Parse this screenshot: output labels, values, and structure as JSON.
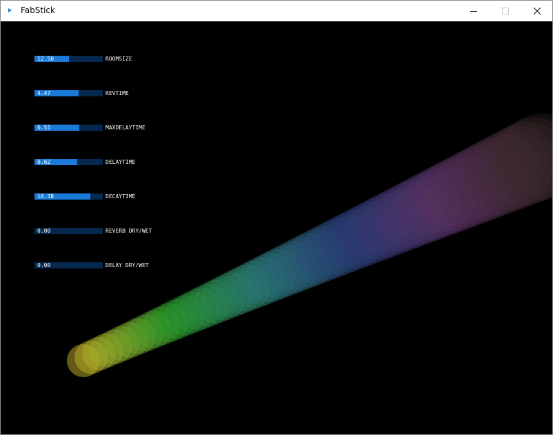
{
  "window": {
    "title": "FabStick",
    "minimize_icon": "minimize-icon",
    "maximize_icon": "maximize-icon",
    "close_icon": "close-icon"
  },
  "sliders": [
    {
      "value": "12.50",
      "label": "ROOMSIZE",
      "fill_fraction": 0.5
    },
    {
      "value": "4.47",
      "label": "REVTIME",
      "fill_fraction": 0.65
    },
    {
      "value": "6.51",
      "label": "MAXDELAYTIME",
      "fill_fraction": 0.66
    },
    {
      "value": "0.62",
      "label": "DELAYTIME",
      "fill_fraction": 0.63
    },
    {
      "value": "16.38",
      "label": "DECAYTIME",
      "fill_fraction": 0.82
    },
    {
      "value": "0.00",
      "label": "REVERB DRY/WET",
      "fill_fraction": 0.0
    },
    {
      "value": "0.00",
      "label": "DELAY DRY/WET",
      "fill_fraction": 0.0
    }
  ],
  "colors": {
    "slider_track": "#05294e",
    "slider_fill": "#1a7ad8",
    "background": "#000000",
    "trail_start": "#c8b42a",
    "trail_green": "#2a9a2a",
    "trail_teal": "#2a7878",
    "trail_blue": "#2a3c78",
    "trail_purple": "#5a3264",
    "trail_end": "#3c2a2a"
  }
}
